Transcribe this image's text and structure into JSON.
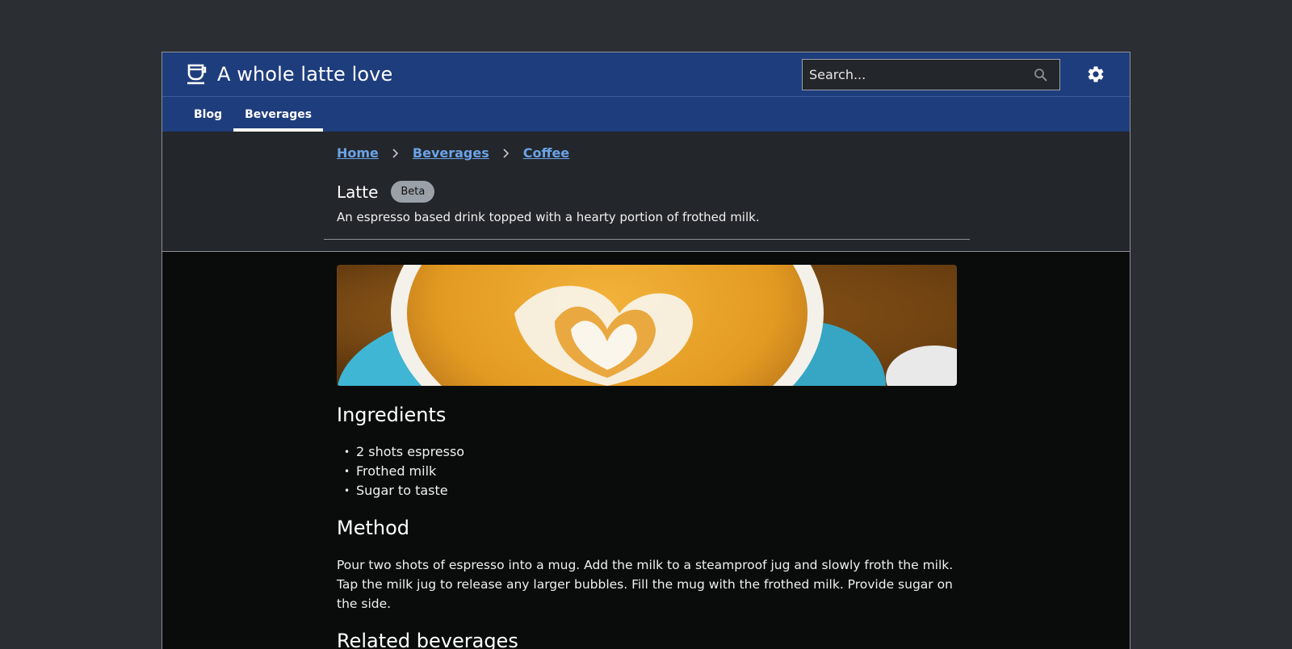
{
  "app": {
    "title": "A whole latte love"
  },
  "search": {
    "placeholder": "Search..."
  },
  "nav": {
    "items": [
      {
        "label": "Blog"
      },
      {
        "label": "Beverages"
      }
    ],
    "active": "Beverages"
  },
  "breadcrumb": [
    "Home",
    "Beverages",
    "Coffee"
  ],
  "page": {
    "title": "Latte",
    "badge": "Beta",
    "subtitle": "An espresso based drink topped with a hearty portion of frothed milk."
  },
  "ingredients": {
    "heading": "Ingredients",
    "items": [
      "2 shots espresso",
      "Frothed milk",
      "Sugar to taste"
    ]
  },
  "method": {
    "heading": "Method",
    "text": "Pour two shots of espresso into a mug. Add the milk to a steamproof jug and slowly froth the milk. Tap the milk jug to release any larger bubbles. Fill the mug with the frothed milk. Provide sugar on the side."
  },
  "related": {
    "heading": "Related beverages"
  },
  "colors": {
    "brand": "#1e3d7c",
    "link": "#6ba2e6",
    "badge": "#9aa0a8",
    "background": "#0a0c0c"
  },
  "icons": {
    "brand": "coffee-cup-icon",
    "search": "search-icon",
    "settings": "gear-icon",
    "breadcrumb_sep": "chevron-right-icon"
  }
}
